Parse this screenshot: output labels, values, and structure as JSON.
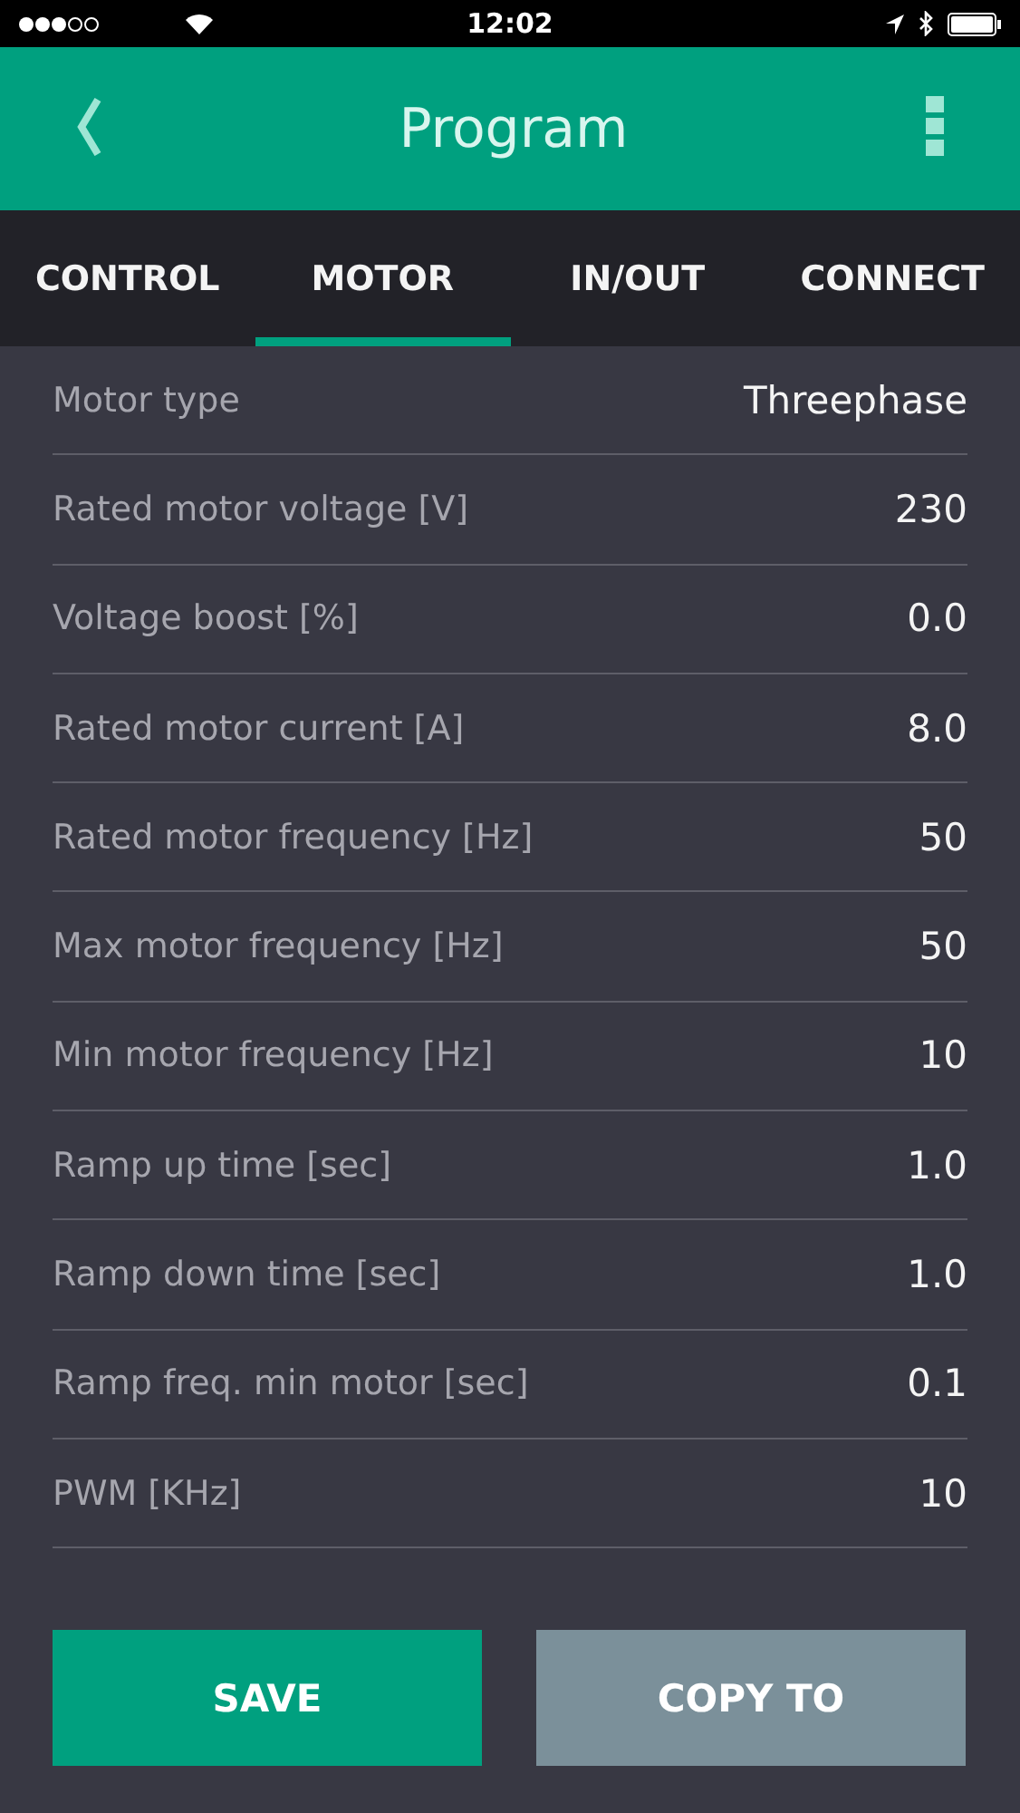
{
  "status_bar": {
    "time": "12:02"
  },
  "header": {
    "title": "Program"
  },
  "tabs": [
    {
      "label": "CONTROL",
      "selected": false
    },
    {
      "label": "MOTOR",
      "selected": true
    },
    {
      "label": "IN/OUT",
      "selected": false
    },
    {
      "label": "CONNECT",
      "selected": false
    }
  ],
  "parameters": [
    {
      "label": "Motor type",
      "value": "Threephase"
    },
    {
      "label": "Rated motor voltage [V]",
      "value": "230"
    },
    {
      "label": "Voltage boost [%]",
      "value": "0.0"
    },
    {
      "label": "Rated motor current [A]",
      "value": "8.0"
    },
    {
      "label": "Rated motor frequency [Hz]",
      "value": "50"
    },
    {
      "label": "Max motor frequency [Hz]",
      "value": "50"
    },
    {
      "label": "Min motor frequency [Hz]",
      "value": "10"
    },
    {
      "label": "Ramp up time [sec]",
      "value": "1.0"
    },
    {
      "label": "Ramp down time [sec]",
      "value": "1.0"
    },
    {
      "label": "Ramp freq. min motor [sec]",
      "value": "0.1"
    },
    {
      "label": "PWM [KHz]",
      "value": "10"
    }
  ],
  "buttons": [
    {
      "label": "SAVE",
      "kind": "primary"
    },
    {
      "label": "COPY TO",
      "kind": "secondary"
    }
  ]
}
